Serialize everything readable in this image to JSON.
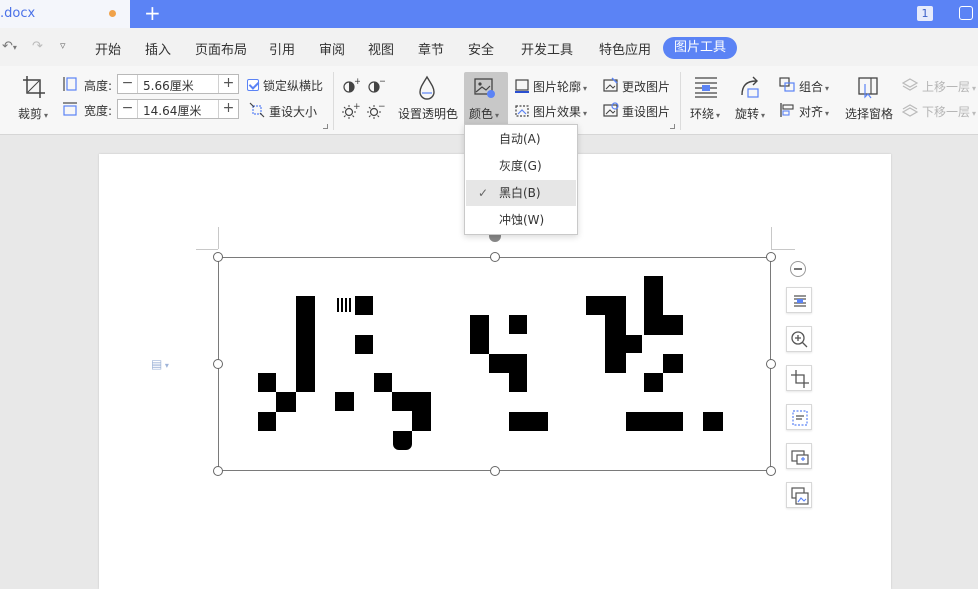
{
  "titlebar": {
    "tab_label": ".docx",
    "new_tab": "+",
    "page_count": "1"
  },
  "menubar": {
    "items": [
      "开始",
      "插入",
      "页面布局",
      "引用",
      "审阅",
      "视图",
      "章节",
      "安全",
      "开发工具",
      "特色应用"
    ],
    "active": "图片工具"
  },
  "ribbon": {
    "crop": "裁剪",
    "height_label": "高度:",
    "height_value": "5.66厘米",
    "width_label": "宽度:",
    "width_value": "14.64厘米",
    "lock_ratio": "锁定纵横比",
    "reset_size": "重设大小",
    "set_transparent": "设置透明色",
    "color": "颜色",
    "picture_outline": "图片轮廓",
    "picture_effects": "图片效果",
    "change_picture": "更改图片",
    "reset_picture": "重设图片",
    "wrap": "环绕",
    "rotate": "旋转",
    "group": "组合",
    "align": "对齐",
    "selection_pane": "选择窗格",
    "bring_forward": "上移一层",
    "send_backward": "下移一层"
  },
  "color_dropdown": {
    "items": [
      "自动(A)",
      "灰度(G)",
      "黑白(B)",
      "冲蚀(W)"
    ],
    "selected_index": 2
  },
  "colors": {
    "accent": "#5b83f5",
    "ribbon_bg": "#f7f7f7",
    "doc_bg": "#e8e8e8"
  }
}
